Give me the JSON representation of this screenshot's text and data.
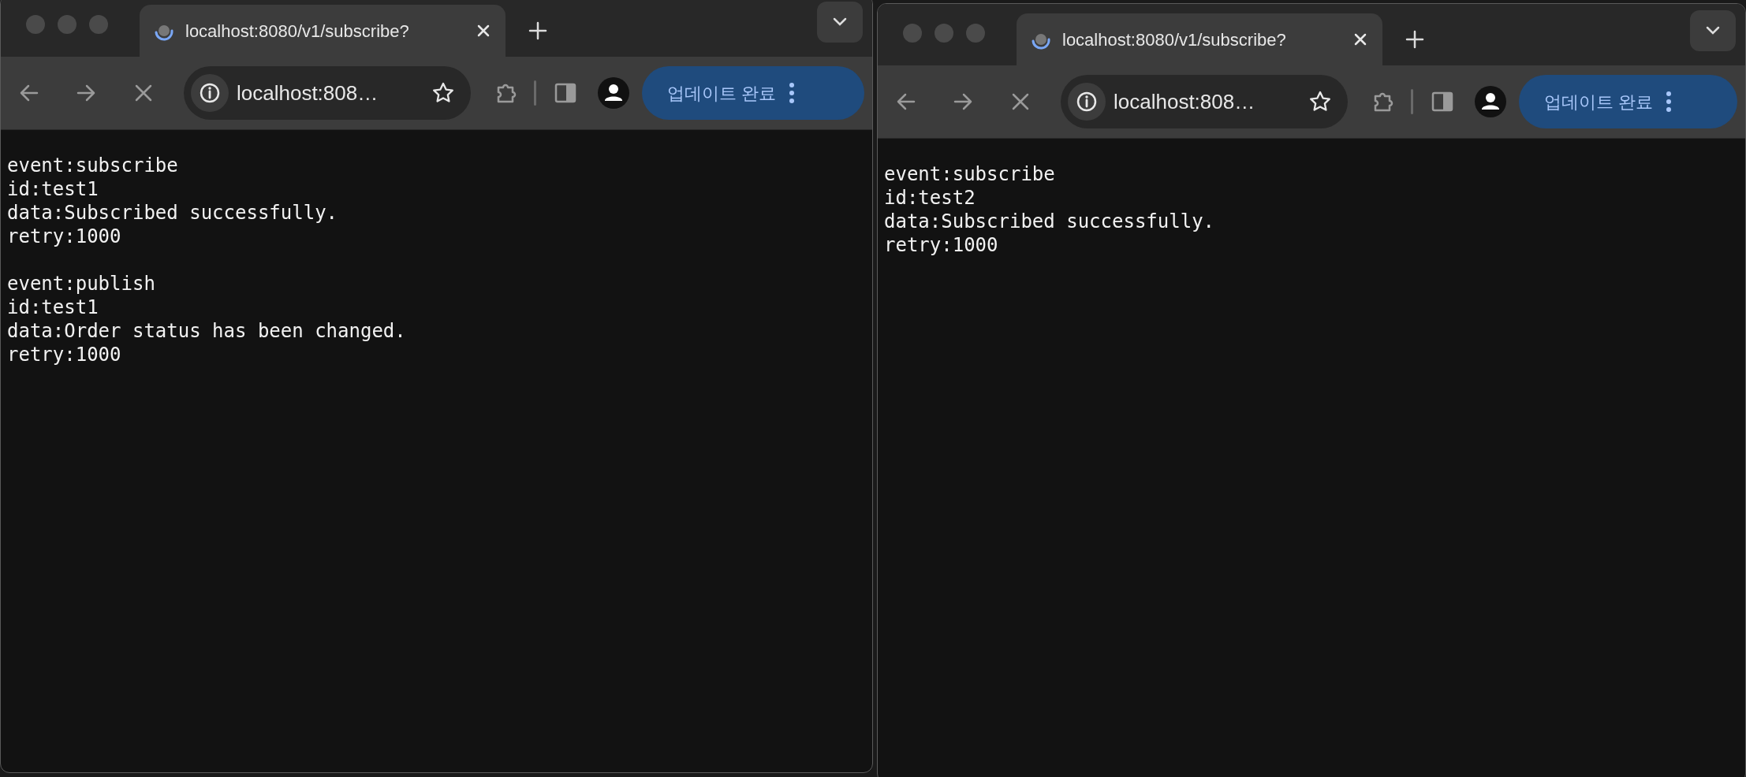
{
  "windows": [
    {
      "tab": {
        "title": "localhost:8080/v1/subscribe?",
        "loading": true
      },
      "address": "localhost:808…",
      "update_button": "업데이트 완료",
      "events": [
        {
          "lines": [
            "event:subscribe",
            "id:test1",
            "data:Subscribed successfully.",
            "retry:1000"
          ]
        },
        {
          "lines": [
            "event:publish",
            "id:test1",
            "data:Order status has been changed.",
            "retry:1000"
          ]
        }
      ]
    },
    {
      "tab": {
        "title": "localhost:8080/v1/subscribe?",
        "loading": true
      },
      "address": "localhost:808…",
      "update_button": "업데이트 완료",
      "events": [
        {
          "lines": [
            "event:subscribe",
            "id:test2",
            "data:Subscribed successfully.",
            "retry:1000"
          ]
        }
      ]
    }
  ]
}
